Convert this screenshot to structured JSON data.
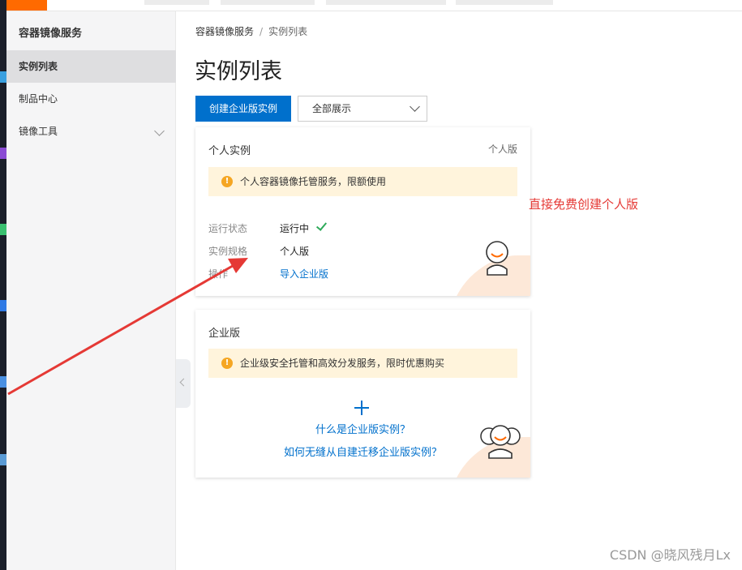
{
  "sidebar": {
    "title": "容器镜像服务",
    "items": [
      {
        "label": "实例列表",
        "active": true
      },
      {
        "label": "制品中心",
        "active": false
      },
      {
        "label": "镜像工具",
        "active": false,
        "expandable": true
      }
    ]
  },
  "breadcrumb": {
    "root": "容器镜像服务",
    "separator": "/",
    "current": "实例列表"
  },
  "page": {
    "title": "实例列表",
    "create_button": "创建企业版实例",
    "filter_select": {
      "value": "全部展示"
    }
  },
  "personal_card": {
    "title": "个人实例",
    "tag": "个人版",
    "notice": "个人容器镜像托管服务，限额使用",
    "rows": [
      {
        "label": "运行状态",
        "value": "运行中"
      },
      {
        "label": "实例规格",
        "value": "个人版"
      },
      {
        "label": "操作",
        "value": "导入企业版"
      }
    ]
  },
  "enterprise_card": {
    "title": "企业版",
    "notice": "企业级安全托管和高效分发服务，限时优惠购买",
    "link_what": "什么是企业版实例？",
    "link_migrate": "如何无缝从自建迁移企业版实例？"
  },
  "annotation": {
    "text": "直接免费创建个人版",
    "color": "#e53935"
  },
  "watermark": "CSDN @晓风残月Lx",
  "colors": {
    "primary": "#0070cc",
    "brand_orange": "#ff6a00",
    "notice_bg": "#fff4dc",
    "success": "#2eaa5a"
  },
  "icons": {
    "notice": "warning-icon",
    "status": "check-icon",
    "add": "plus-icon"
  }
}
